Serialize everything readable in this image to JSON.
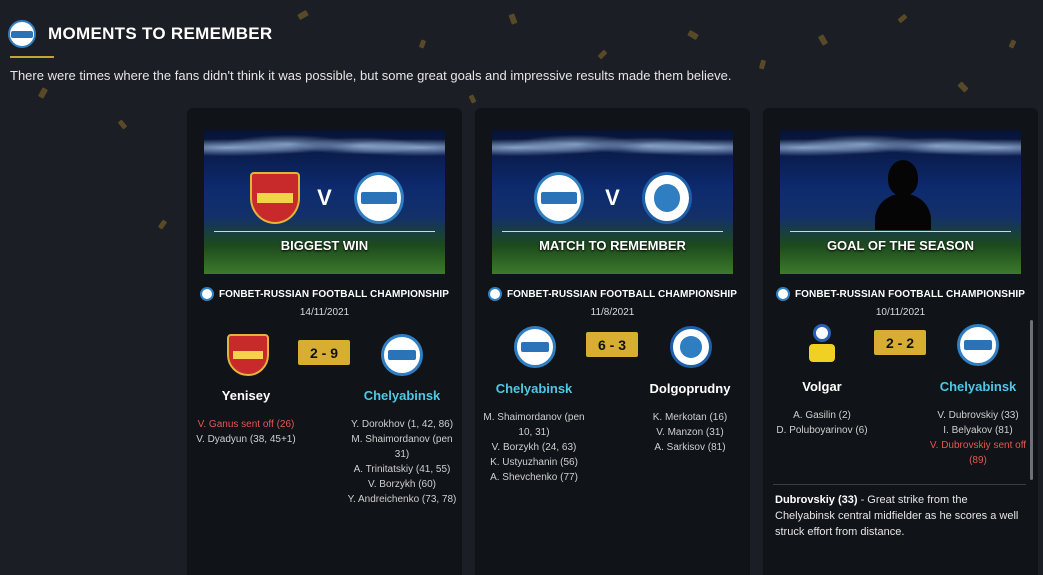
{
  "header": {
    "club_logo_icon": "chelyabinsk-crest-icon",
    "title": "MOMENTS TO REMEMBER",
    "subtitle": "There were times where the fans didn't think it was possible, but some great goals and impressive results made them believe."
  },
  "colors": {
    "background": "#1b1e24",
    "card": "#101317",
    "score_badge": "#d7ad32",
    "highlight_team": "#4fc7e6",
    "red_card": "#e4584e",
    "accent_underline": "#c9a233"
  },
  "cards": [
    {
      "banner_label": "BIGGEST WIN",
      "vs": "V",
      "competition": "FONBET-RUSSIAN FOOTBALL CHAMPIONSHIP",
      "date": "14/11/2021",
      "score": "2 - 9",
      "home_team": "Yenisey",
      "away_team": "Chelyabinsk",
      "home_events": [
        "V. Ganus sent off (26)",
        "V. Dyadyun (38, 45+1)"
      ],
      "away_events": [
        "Y. Dorokhov (1, 42, 86)",
        "M. Shaimordanov (pen 31)",
        "A. Trinitatskiy (41, 55)",
        "V. Borzykh (60)",
        "Y. Andreichenko (73, 78)"
      ]
    },
    {
      "banner_label": "MATCH TO REMEMBER",
      "vs": "V",
      "competition": "FONBET-RUSSIAN FOOTBALL CHAMPIONSHIP",
      "date": "11/8/2021",
      "score": "6 - 3",
      "home_team": "Chelyabinsk",
      "away_team": "Dolgoprudny",
      "home_events": [
        "M. Shaimordanov (pen 10, 31)",
        "V. Borzykh (24, 63)",
        "K. Ustyuzhanin (56)",
        "A. Shevchenko (77)"
      ],
      "away_events": [
        "K. Merkotan (16)",
        "V. Manzon (31)",
        "A. Sarkisov (81)"
      ]
    },
    {
      "banner_label": "GOAL OF THE SEASON",
      "competition": "FONBET-RUSSIAN FOOTBALL CHAMPIONSHIP",
      "date": "10/11/2021",
      "score": "2 - 2",
      "home_team": "Volgar",
      "away_team": "Chelyabinsk",
      "home_events": [
        "A. Gasilin (2)",
        "D. Poluboyarinov (6)"
      ],
      "away_events": [
        "V. Dubrovskiy (33)",
        "I. Belyakov (81)",
        "V. Dubrovskiy sent off (89)"
      ],
      "goal_scorer": "Dubrovskiy (33)",
      "goal_description": " - Great strike from the Chelyabinsk central midfielder as he scores a well struck effort from distance."
    }
  ]
}
